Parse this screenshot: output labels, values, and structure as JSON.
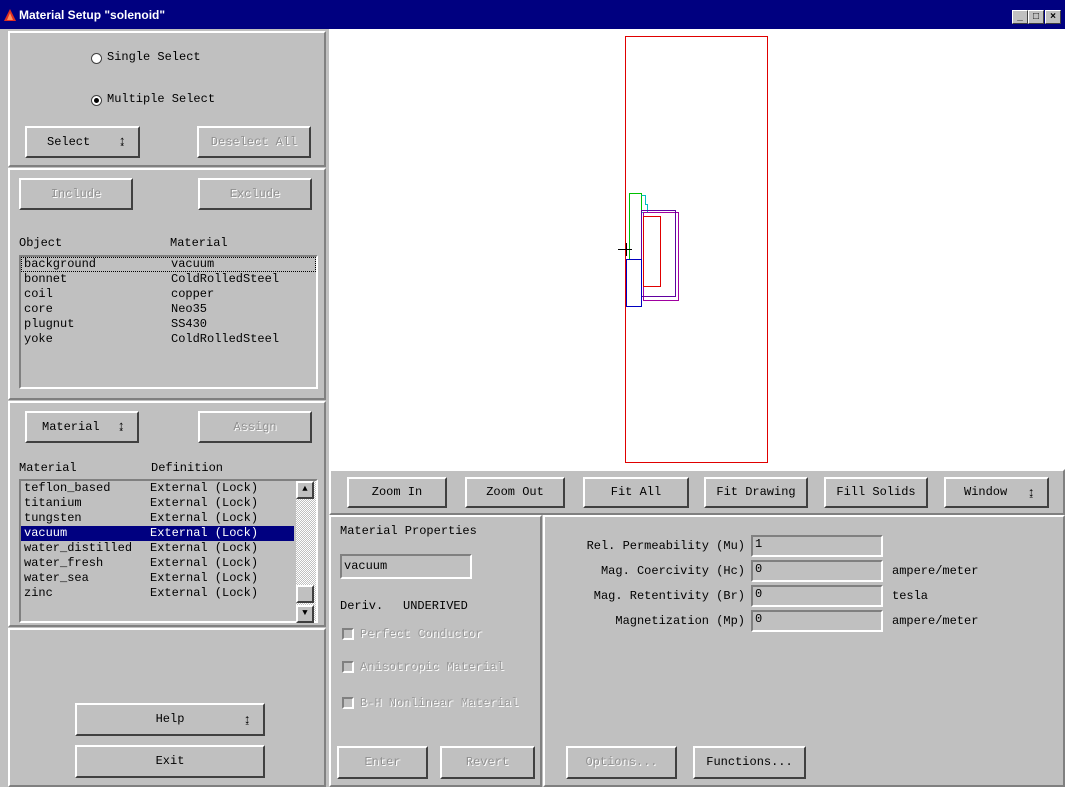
{
  "window": {
    "title": "Material Setup \"solenoid\"",
    "min": "_",
    "max": "□",
    "close": "×"
  },
  "select_panel": {
    "single_select": "Single Select",
    "multiple_select": "Multiple Select",
    "select_btn": "Select",
    "deselect_all_btn": "Deselect All"
  },
  "object_panel": {
    "include_btn": "Include",
    "exclude_btn": "Exclude",
    "col_object": "Object",
    "col_material": "Material",
    "rows": [
      {
        "object": "background",
        "material": "vacuum"
      },
      {
        "object": "bonnet",
        "material": "ColdRolledSteel"
      },
      {
        "object": "coil",
        "material": "copper"
      },
      {
        "object": "core",
        "material": "Neo35"
      },
      {
        "object": "plugnut",
        "material": "SS430"
      },
      {
        "object": "yoke",
        "material": "ColdRolledSteel"
      }
    ]
  },
  "material_panel": {
    "material_btn": "Material",
    "assign_btn": "Assign",
    "col_material": "Material",
    "col_definition": "Definition",
    "rows": [
      {
        "material": "teflon_based",
        "definition": "External (Lock)"
      },
      {
        "material": "titanium",
        "definition": "External (Lock)"
      },
      {
        "material": "tungsten",
        "definition": "External (Lock)"
      },
      {
        "material": "vacuum",
        "definition": "External (Lock)"
      },
      {
        "material": "water_distilled",
        "definition": "External (Lock)"
      },
      {
        "material": "water_fresh",
        "definition": "External (Lock)"
      },
      {
        "material": "water_sea",
        "definition": "External (Lock)"
      },
      {
        "material": "zinc",
        "definition": "External (Lock)"
      }
    ],
    "selected_index": 3
  },
  "bottom_left": {
    "help_btn": "Help",
    "exit_btn": "Exit"
  },
  "toolbar": {
    "zoom_in": "Zoom In",
    "zoom_out": "Zoom Out",
    "fit_all": "Fit All",
    "fit_drawing": "Fit Drawing",
    "fill_solids": "Fill Solids",
    "window": "Window"
  },
  "properties": {
    "heading": "Material Properties",
    "name_value": "vacuum",
    "deriv_label": "Deriv.",
    "deriv_value": "UNDERIVED",
    "perfect_conductor": "Perfect Conductor",
    "anisotropic": "Anisotropic Material",
    "bh_nonlinear": "B-H Nonlinear Material",
    "enter_btn": "Enter",
    "revert_btn": "Revert"
  },
  "params": {
    "rows": [
      {
        "label": "Rel. Permeability (Mu)",
        "value": "1",
        "unit": ""
      },
      {
        "label": "Mag. Coercivity (Hc)",
        "value": "0",
        "unit": "ampere/meter"
      },
      {
        "label": "Mag. Retentivity (Br)",
        "value": "0",
        "unit": "tesla"
      },
      {
        "label": "Magnetization (Mp)",
        "value": "0",
        "unit": "ampere/meter"
      }
    ],
    "options_btn": "Options...",
    "functions_btn": "Functions..."
  },
  "colors": {
    "titlebar": "#000080",
    "selection": "#000080",
    "face": "#c0c0c0",
    "canvas": "#ffffff"
  }
}
